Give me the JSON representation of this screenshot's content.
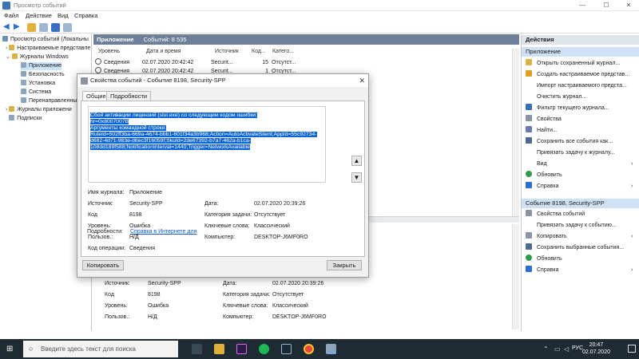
{
  "window": {
    "title": "Просмотр событий",
    "controls": [
      "—",
      "☐",
      "✕"
    ]
  },
  "menu": [
    "Файл",
    "Действие",
    "Вид",
    "Справка"
  ],
  "tree": {
    "items": [
      "Просмотр событий (Локальны",
      "Настраиваемые представле",
      "Журналы Windows",
      "Приложение",
      "Безопасность",
      "Установка",
      "Система",
      "Перенаправленны",
      "Журналы приложени",
      "Подписки"
    ]
  },
  "center": {
    "header_title": "Приложение",
    "header_count": "Событий: 8 535",
    "columns": [
      "Уровень",
      "Дата и время",
      "Источник",
      "Код...",
      "Катего..."
    ],
    "rows": [
      {
        "level": "Сведения",
        "date": "02.07.2020 20:42:42",
        "source": "Securit...",
        "code": "15",
        "cat": "Отсутст..."
      },
      {
        "level": "Сведения",
        "date": "02.07.2020 20:42:42",
        "source": "Securit...",
        "code": "1",
        "cat": "Отсутст..."
      }
    ],
    "details": {
      "source_label": "Источник:",
      "source_value": "Security-SPP",
      "date_label": "Дата:",
      "date_value": "02.07.2020 20:39:26",
      "code_label": "Код",
      "code_value": "8198",
      "task_label": "Категория задачи:",
      "task_value": "Отсутствует",
      "level_label": "Уровень:",
      "level_value": "Ошибка",
      "keywords_label": "Ключевые слова:",
      "keywords_value": "Классический",
      "user_label": "Пользов.:",
      "user_value": "Н/Д",
      "computer_label": "Компьютер:",
      "computer_value": "DESKTOP-J6MF0RO"
    }
  },
  "actions": {
    "header": "Действия",
    "section1": "Приложение",
    "items1": [
      "Открыть сохраненный журнал...",
      "Создать настраиваемое представ...",
      "Импорт настраиваемого предста...",
      "Очистить журнал...",
      "Фильтр текущего журнала...",
      "Свойства",
      "Найти...",
      "Сохранить все события как...",
      "Привязать задачу к журналу...",
      "Вид",
      "Обновить",
      "Справка"
    ],
    "section2": "Событие 8198, Security-SPP",
    "items2": [
      "Свойства событий",
      "Привязать задачу к событию...",
      "Копировать",
      "Сохранить выбранные события...",
      "Обновить",
      "Справка"
    ]
  },
  "dialog": {
    "title": "Свойства событий - Событие 8198, Security-SPP",
    "close": "✕",
    "tabs": [
      "Общие",
      "Подробности"
    ],
    "message_lines": [
      "Сбой активации лицензий (slui.exe) со следующим кодом ошибки:",
      "hr=0x8007007B",
      "Аргументы командной строки:",
      "RuleId=502ff3ba-669a-4674-bbb1-601f34a3b968;Action=AutoActivateSilent;AppId=55c92734-",
      "d682-4d71-983e-d6ec3f16059f;SkuId=2de67392-b7a7-462a-b1ca-",
      "108dd189f588;NotificationInterval=1440;Trigger=NetworkAvailable"
    ],
    "fields": {
      "log_label": "Имя журнала:",
      "log_value": "Приложение",
      "source_label": "Источник:",
      "source_value": "Security-SPP",
      "date_label": "Дата:",
      "date_value": "02.07.2020 20:39:26",
      "code_label": "Код",
      "code_value": "8198",
      "task_label": "Категория задачи:",
      "task_value": "Отсутствует",
      "level_label": "Уровень:",
      "level_value": "Ошибка",
      "keywords_label": "Ключевые слова:",
      "keywords_value": "Классический",
      "user_label": "Пользов.:",
      "user_value": "Н/Д",
      "computer_label": "Компьютер:",
      "computer_value": "DESKTOP-J6MF0RO",
      "opcode_label": "Код операции:",
      "opcode_value": "Сведения",
      "more_label": "Подробности:",
      "more_link": "Справка в Интернете для"
    },
    "copy_button": "Копировать",
    "close_button": "Закрыть"
  },
  "taskbar": {
    "search_placeholder": "Введите здесь текст для поиска",
    "language": "РУС",
    "time": "20:47",
    "date": "02.07.2020"
  },
  "colors": {
    "header_bar": "#6e7f99",
    "selection": "#0a64d6",
    "link": "#0b57c8",
    "taskbar": "#1f2b33"
  }
}
